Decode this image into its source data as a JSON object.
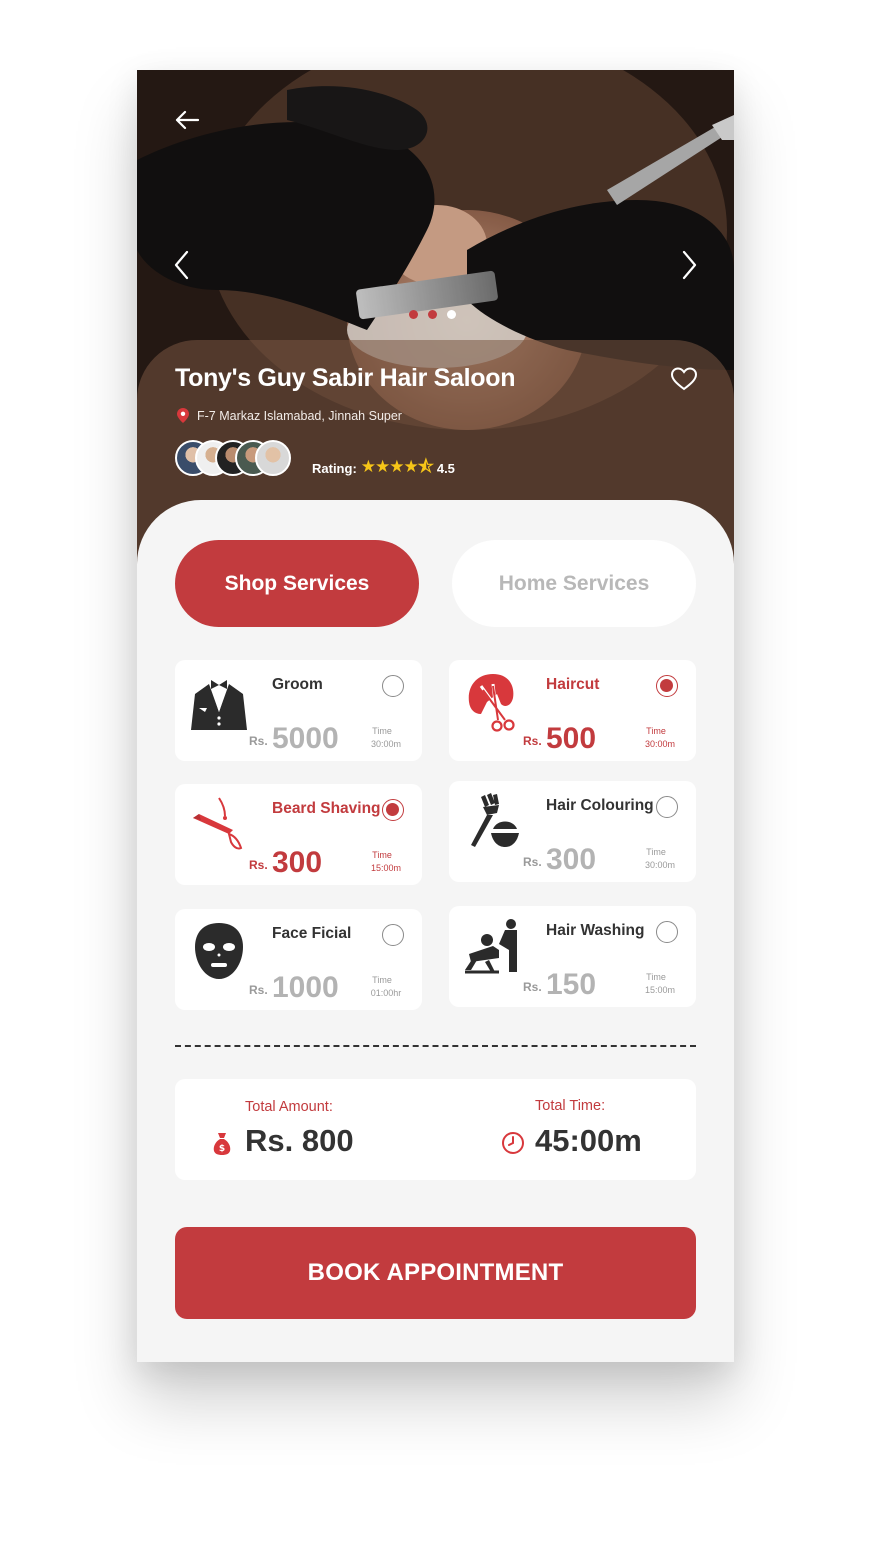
{
  "shop": {
    "name": "Tony's Guy Sabir Hair Saloon",
    "address": "F-7 Markaz Islamabad, Jinnah Super",
    "rating_label": "Rating:",
    "rating_value": "4.5",
    "stars": "★★★★⯪"
  },
  "carousel": {
    "slide_count": 3,
    "active_slide": 3
  },
  "tabs": {
    "shop": "Shop Services",
    "home": "Home Services",
    "active": "shop"
  },
  "services": [
    {
      "name": "Groom",
      "currency": "Rs.",
      "price": "5000",
      "time_label": "Time",
      "time": "30:00m",
      "selected": false,
      "icon": "tuxedo-icon"
    },
    {
      "name": "Haircut",
      "currency": "Rs.",
      "price": "500",
      "time_label": "Time",
      "time": "30:00m",
      "selected": true,
      "icon": "haircut-scissors-icon"
    },
    {
      "name": "Beard Shaving",
      "currency": "Rs.",
      "price": "300",
      "time_label": "Time",
      "time": "15:00m",
      "selected": true,
      "icon": "razor-icon"
    },
    {
      "name": "Hair Colouring",
      "currency": "Rs.",
      "price": "300",
      "time_label": "Time",
      "time": "30:00m",
      "selected": false,
      "icon": "hair-dye-icon"
    },
    {
      "name": "Face Ficial",
      "currency": "Rs.",
      "price": "1000",
      "time_label": "Time",
      "time": "01:00hr",
      "selected": false,
      "icon": "face-mask-icon"
    },
    {
      "name": "Hair Washing",
      "currency": "Rs.",
      "price": "150",
      "time_label": "Time",
      "time": "15:00m",
      "selected": false,
      "icon": "hair-washing-icon"
    }
  ],
  "summary": {
    "amount_label": "Total Amount:",
    "amount_value": "Rs. 800",
    "time_label": "Total Time:",
    "time_value": "45:00m"
  },
  "book_button": "BOOK APPOINTMENT",
  "colors": {
    "accent": "#c23b3e",
    "background": "#f5f5f5",
    "card": "#ffffff",
    "text_dark": "#333333",
    "muted": "#b3b3b3",
    "star": "#f6c518"
  }
}
